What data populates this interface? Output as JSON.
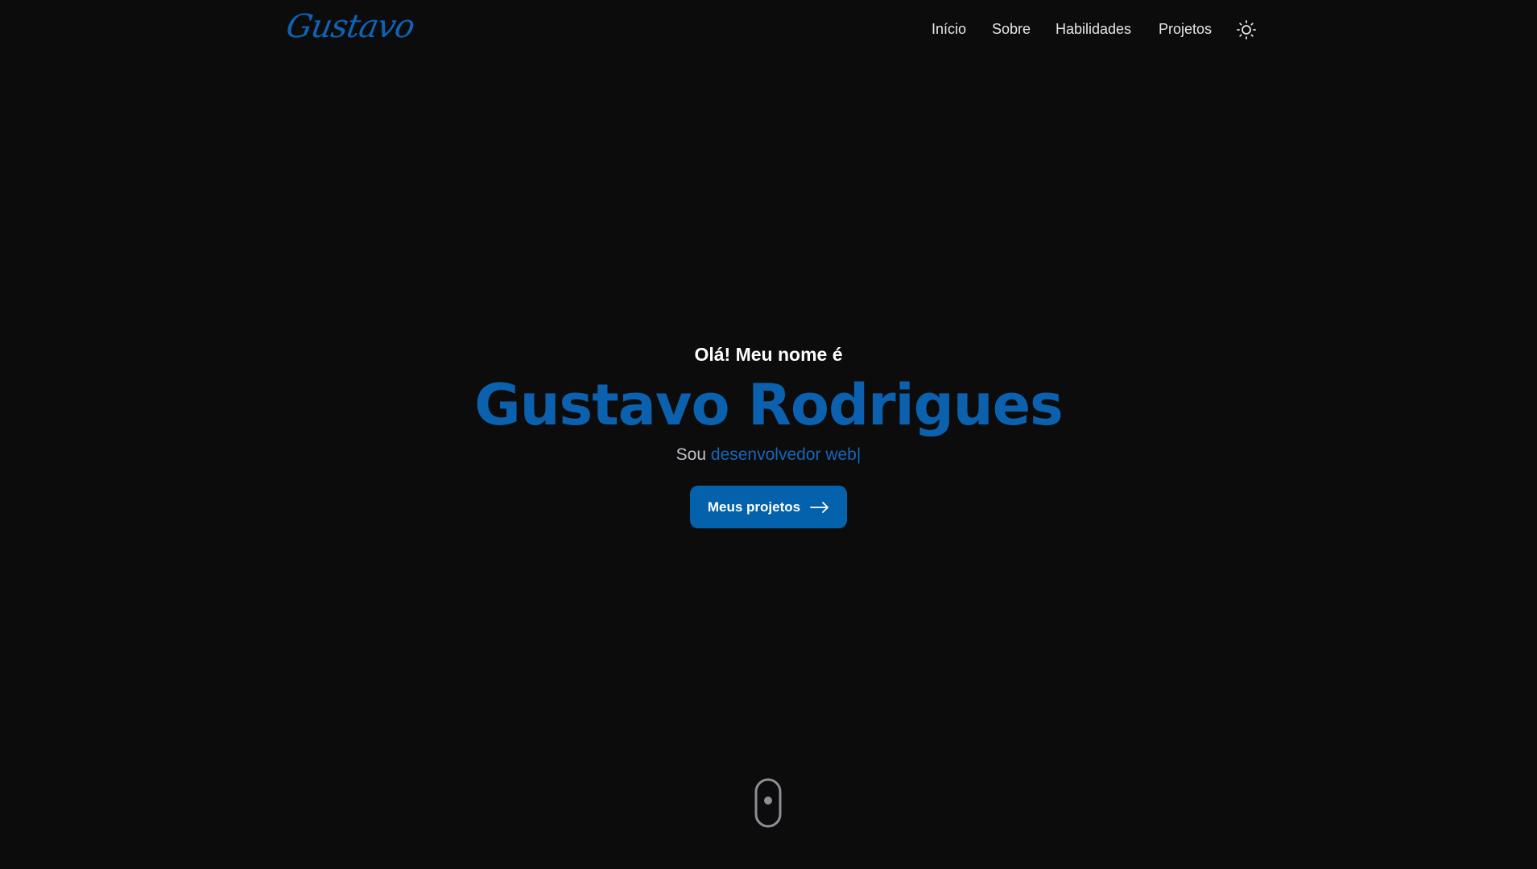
{
  "header": {
    "logo_text": "Gustavo",
    "nav": {
      "inicio": "Início",
      "sobre": "Sobre",
      "habilidades": "Habilidades",
      "projetos": "Projetos"
    },
    "theme_toggle_icon": "sun-icon"
  },
  "hero": {
    "greeting": "Olá! Meu nome é",
    "name": "Gustavo Rodrigues",
    "role_prefix": "Sou",
    "role_highlight": "desenvolvedor web",
    "caret": "|",
    "cta_label": "Meus projetos",
    "cta_icon": "arrow-right-icon"
  },
  "scroll_indicator_icon": "mouse-scroll-icon",
  "colors": {
    "background": "#0c0c0d",
    "accent": "#0c61ae",
    "button": "#0461ac",
    "nav_text": "#e6e6e6"
  }
}
